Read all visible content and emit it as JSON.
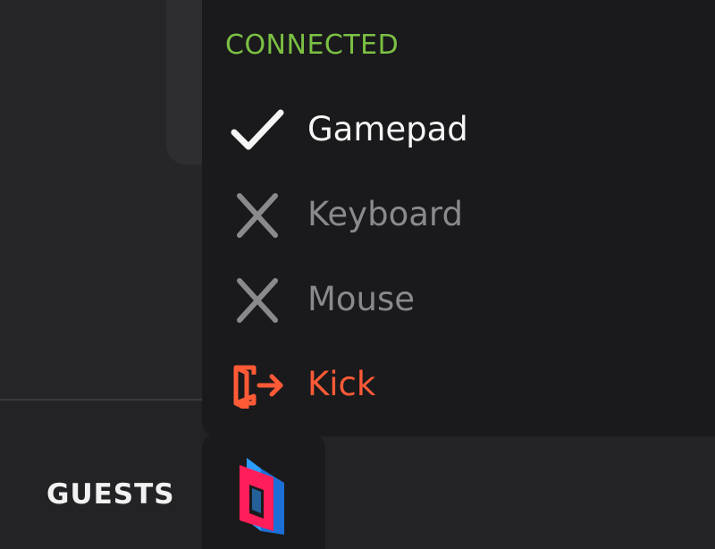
{
  "connected_menu": {
    "section_title": "CONNECTED",
    "items": [
      {
        "label": "Gamepad",
        "state": "connected",
        "icon": "check-icon"
      },
      {
        "label": "Keyboard",
        "state": "disconnected",
        "icon": "x-icon"
      },
      {
        "label": "Mouse",
        "state": "disconnected",
        "icon": "x-icon"
      },
      {
        "label": "Kick",
        "state": "action",
        "icon": "kick-exit-icon"
      }
    ]
  },
  "bottom_bar": {
    "guests_label": "GUESTS"
  },
  "colors": {
    "connected_title": "#7bc043",
    "enabled_text": "#f5f5f5",
    "disabled_text": "#8a8a8c",
    "danger": "#ff5a36",
    "logo_red": "#ff1e5a",
    "logo_blue": "#2c9cff"
  }
}
